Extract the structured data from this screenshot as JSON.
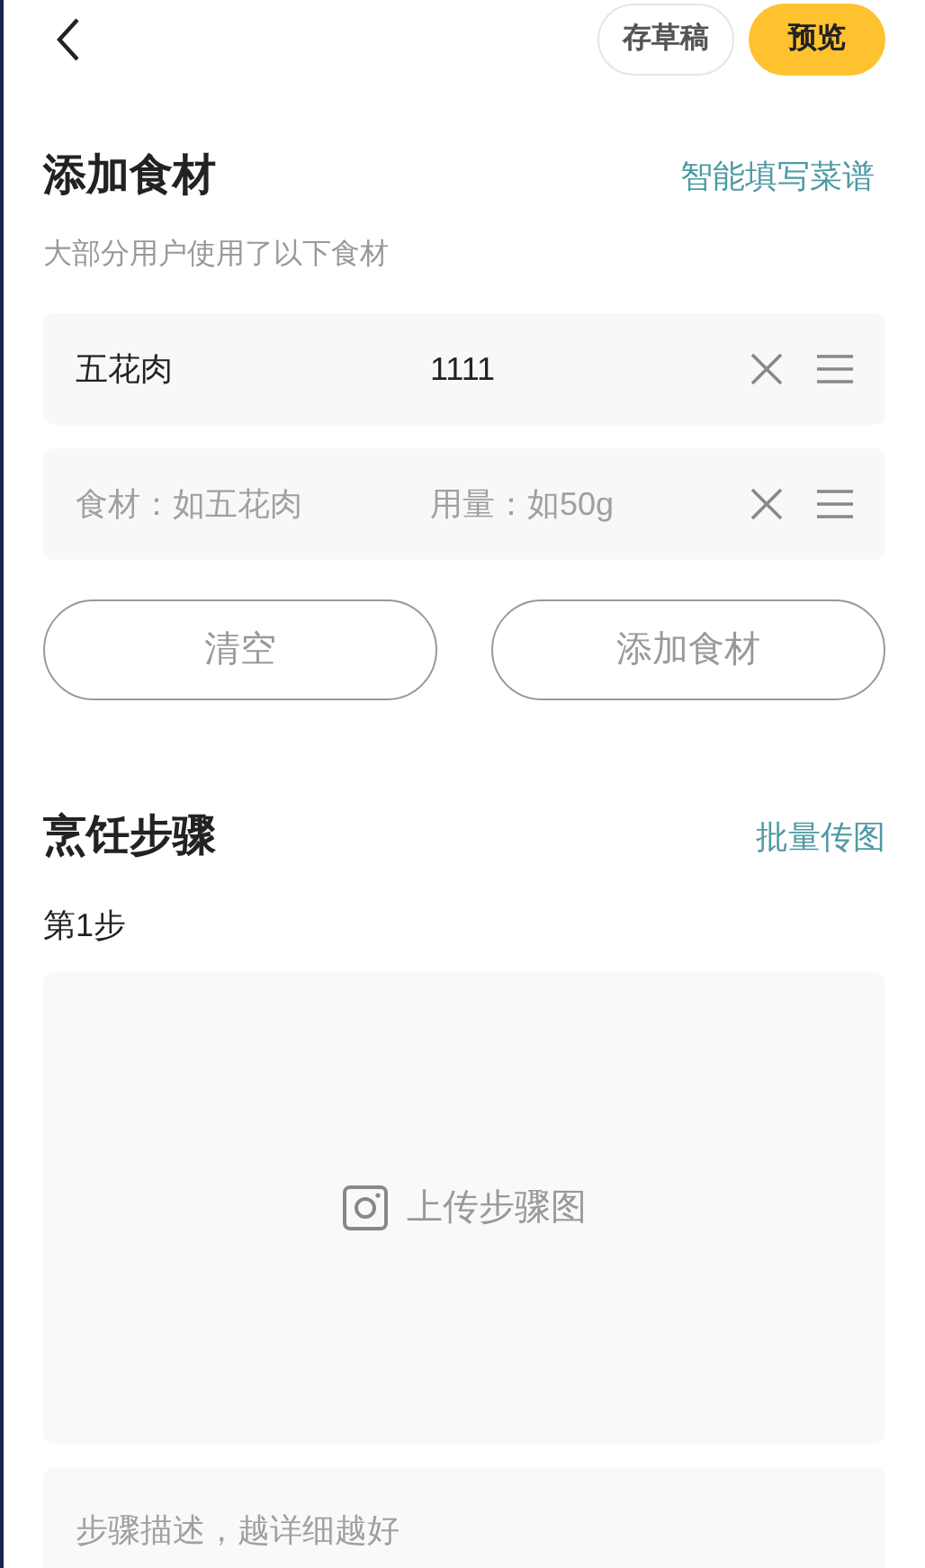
{
  "header": {
    "draft_button": "存草稿",
    "preview_button": "预览"
  },
  "ingredients": {
    "title": "添加食材",
    "action": "智能填写菜谱",
    "subtitle": "大部分用户使用了以下食材",
    "rows": [
      {
        "name": {
          "value": "五花肉"
        },
        "amount": {
          "value": "1111"
        }
      },
      {
        "name": {
          "placeholder": "食材：如五花肉"
        },
        "amount": {
          "placeholder": "用量：如50g"
        }
      }
    ],
    "buttons": [
      "清空",
      "添加食材"
    ]
  },
  "steps": {
    "title": "烹饪步骤",
    "action": "批量传图",
    "items": [
      {
        "label": "第1步",
        "upload": "上传步骤图",
        "description": {
          "placeholder": "步骤描述，越详细越好"
        }
      }
    ]
  }
}
